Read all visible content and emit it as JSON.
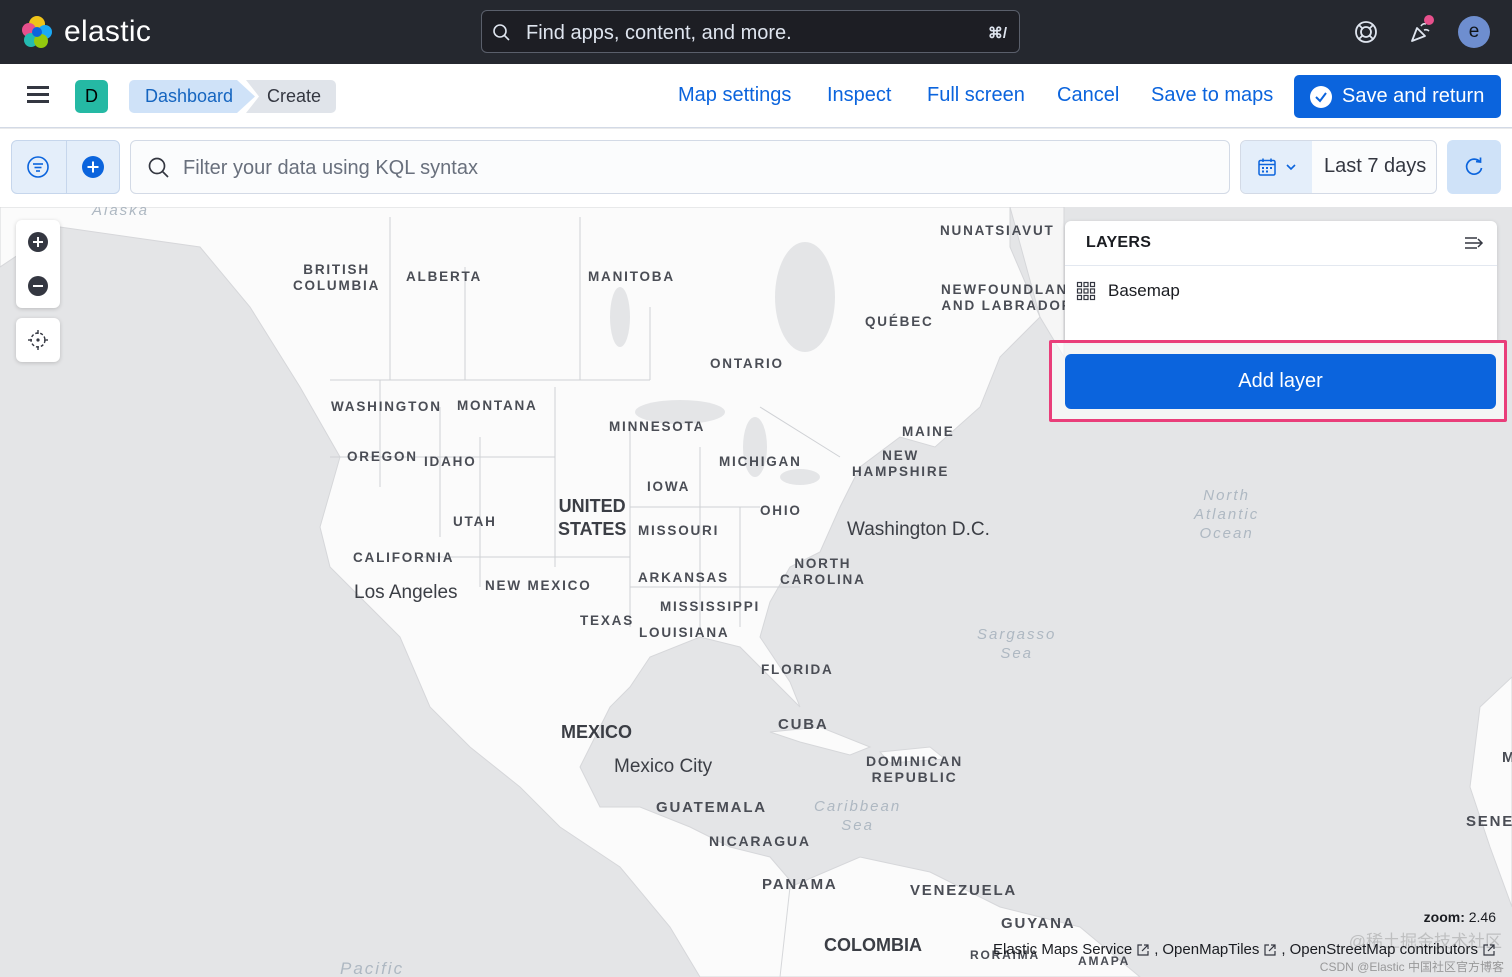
{
  "header": {
    "logo_text": "elastic",
    "search_placeholder": "Find apps, content, and more.",
    "search_shortcut": "⌘/",
    "avatar_initial": "e",
    "colors": {
      "bg": "#25282f",
      "notification": "#e7508c",
      "avatar": "#6e8ecf"
    }
  },
  "nav": {
    "space_initial": "D",
    "breadcrumbs": [
      "Dashboard",
      "Create"
    ],
    "links": {
      "map_settings": "Map settings",
      "inspect": "Inspect",
      "full_screen": "Full screen",
      "cancel": "Cancel",
      "save_to_maps": "Save to maps"
    },
    "save_and_return": "Save and return",
    "colors": {
      "primary": "#0b64dd",
      "space_badge": "#25b9a4"
    }
  },
  "query": {
    "placeholder": "Filter your data using KQL syntax",
    "date_range": "Last 7 days"
  },
  "map": {
    "state_labels": {
      "british_columbia": "BRITISH\nCOLUMBIA",
      "alberta": "ALBERTA",
      "manitoba": "MANITOBA",
      "nunatsiavut": "NUNATSIAVUT",
      "newfoundland": "NEWFOUNDLANI\nAND LABRADOR",
      "quebec": "QUÉBEC",
      "ontario": "ONTARIO",
      "washington": "WASHINGTON",
      "montana": "MONTANA",
      "minnesota": "MINNESOTA",
      "maine": "MAINE",
      "oregon": "OREGON",
      "idaho": "IDAHO",
      "michigan": "MICHIGAN",
      "new_hampshire": "NEW\nHAMPSHIRE",
      "iowa": "IOWA",
      "ohio": "OHIO",
      "utah": "UTAH",
      "missouri": "MISSOURI",
      "california": "CALIFORNIA",
      "new_mexico": "NEW MEXICO",
      "arkansas": "ARKANSAS",
      "north_carolina": "NORTH\nCAROLINA",
      "mississippi": "MISSISSIPPI",
      "texas": "TEXAS",
      "louisiana": "LOUISIANA",
      "florida": "FLORIDA"
    },
    "country_labels": {
      "united_states": "UNITED\nSTATES",
      "mexico": "MEXICO",
      "cuba": "CUBA",
      "dominican_republic": "DOMINICAN\nREPUBLIC",
      "guatemala": "GUATEMALA",
      "nicaragua": "NICARAGUA",
      "panama": "PANAMA",
      "venezuela": "VENEZUELA",
      "guyana": "GUYANA",
      "colombia": "COLOMBIA",
      "roraima": "RORAIMA",
      "amapa": "AMAPA",
      "senegal": "SENEG",
      "m_partial": "M"
    },
    "city_labels": {
      "los_angeles": "Los Angeles",
      "washington_dc": "Washington D.C.",
      "mexico_city": "Mexico City"
    },
    "water_labels": {
      "alaska": "Alaska",
      "north_atlantic": "North\nAtlantic\nOcean",
      "sargasso": "Sargasso\nSea",
      "caribbean": "Caribbean\nSea",
      "pacific": "Pacific"
    },
    "layers": {
      "title": "LAYERS",
      "items": [
        "Basemap"
      ],
      "add_layer": "Add layer"
    },
    "zoom_label": "zoom:",
    "zoom_value": "2.46",
    "attribution": [
      "Elastic Maps Service",
      "OpenMapTiles",
      "OpenStreetMap contributors"
    ],
    "watermark": "@稀土掘金技术社区",
    "watermark2": "CSDN @Elastic 中国社区官方博客"
  }
}
